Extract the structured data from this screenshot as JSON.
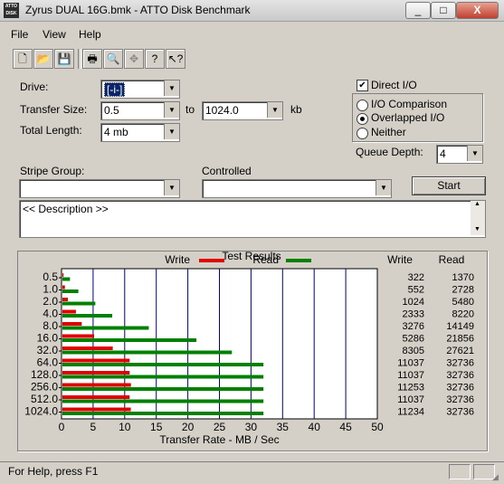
{
  "window": {
    "title": "Zyrus DUAL 16G.bmk - ATTO Disk Benchmark",
    "icon_text": "ATTO DISK",
    "min_label": "_",
    "max_label": "□",
    "close_label": "X"
  },
  "menu": {
    "file": "File",
    "view": "View",
    "help": "Help"
  },
  "toolbar": {
    "icons": [
      "new-icon",
      "open-icon",
      "save-icon",
      "print-icon",
      "print-preview-icon",
      "move-icon",
      "help-icon",
      "context-help-icon"
    ]
  },
  "form": {
    "drive_label": "Drive:",
    "drive_value": "[-i-]",
    "transfer_size_label": "Transfer Size:",
    "transfer_from": "0.5",
    "to_label": "to",
    "transfer_to": "1024.0",
    "kb_label": "kb",
    "total_length_label": "Total Length:",
    "total_length_value": "4 mb",
    "direct_io_label": "Direct I/O",
    "direct_io_checked": true,
    "io_comparison_label": "I/O Comparison",
    "overlapped_io_label": "Overlapped I/O",
    "neither_label": "Neither",
    "selected_io_mode": "overlapped",
    "queue_depth_label": "Queue Depth:",
    "queue_depth_value": "4",
    "stripe_group_label": "Stripe Group:",
    "stripe_group_value": "",
    "controlled_label": "Controlled",
    "controlled_value": "",
    "start_button": "Start",
    "description": "<< Description >>"
  },
  "results": {
    "title": "Test Results"
  },
  "chart_data": {
    "type": "bar",
    "orientation": "horizontal",
    "title": "Test Results",
    "xlabel": "Transfer Rate - MB / Sec",
    "xlim": [
      0,
      50
    ],
    "xticks": [
      "0",
      "5",
      "10",
      "15",
      "20",
      "25",
      "30",
      "35",
      "40",
      "45",
      "50"
    ],
    "categories": [
      "0.5",
      "1.0",
      "2.0",
      "4.0",
      "8.0",
      "16.0",
      "32.0",
      "64.0",
      "128.0",
      "256.0",
      "512.0",
      "1024.0"
    ],
    "series": [
      {
        "name": "Write",
        "color": "#e00000",
        "values": [
          322,
          552,
          1024,
          2333,
          3276,
          5286,
          8305,
          11037,
          11037,
          11253,
          11037,
          11234
        ]
      },
      {
        "name": "Read",
        "color": "#008000",
        "values": [
          1370,
          2728,
          5480,
          8220,
          14149,
          21856,
          27621,
          32736,
          32736,
          32736,
          32736,
          32736
        ]
      }
    ],
    "table_headers": {
      "write": "Write",
      "read": "Read"
    },
    "value_unit_note": "bars show KB/s values scaled to MB/s axis"
  },
  "status": {
    "text": "For Help, press F1"
  }
}
